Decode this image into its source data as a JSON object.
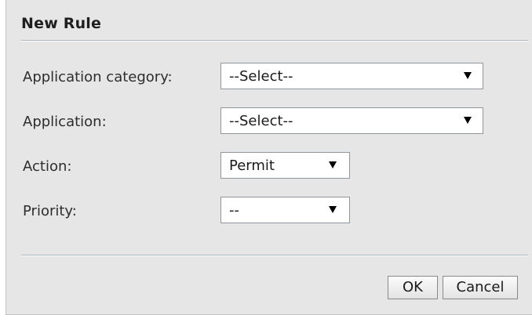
{
  "dialog": {
    "title": "New Rule",
    "fields": [
      {
        "label": "Application category:",
        "value": "--Select--"
      },
      {
        "label": "Application:",
        "value": "--Select--"
      },
      {
        "label": "Action:",
        "value": "Permit"
      },
      {
        "label": "Priority:",
        "value": "--"
      }
    ],
    "buttons": {
      "ok": "OK",
      "cancel": "Cancel"
    }
  },
  "icons": {
    "dropdown": "chevron-down-icon"
  }
}
